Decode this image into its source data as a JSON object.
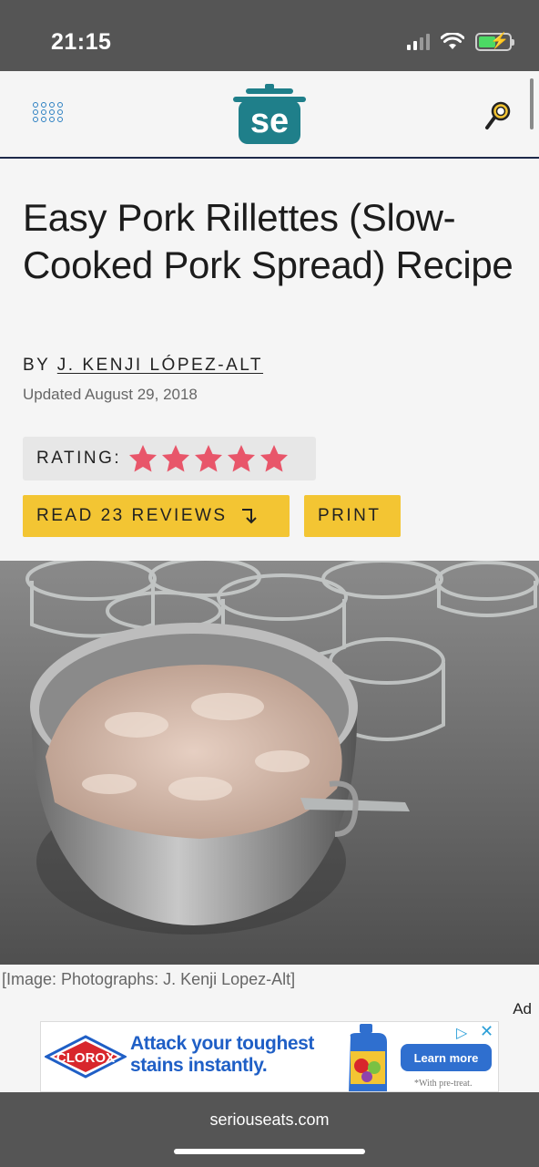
{
  "status_bar": {
    "time": "21:15"
  },
  "header": {
    "logo_text": "se"
  },
  "article": {
    "title": "Easy Pork Rillettes (Slow-Cooked Pork Spread) Recipe",
    "by_prefix": "BY",
    "author": "J. KENJI LÓPEZ-ALT",
    "updated": "Updated August 29, 2018",
    "rating_label": "RATING:",
    "rating_stars": 5,
    "rating_max": 5,
    "reviews_button": "READ 23 REVIEWS",
    "print_button": "PRINT",
    "caption": "[Image: Photographs: J. Kenji Lopez-Alt]"
  },
  "ad": {
    "label": "Ad",
    "brand": "CLOROX",
    "headline_line1": "Attack your toughest",
    "headline_line2": "stains instantly.",
    "cta": "Learn more",
    "fine_print": "*With pre-treat."
  },
  "browser": {
    "url": "seriouseats.com"
  },
  "colors": {
    "accent_yellow": "#f3c533",
    "star_red": "#e8566a",
    "logo_teal": "#1f7f8a",
    "chrome_gray": "#555555"
  },
  "icons": [
    "menu-grid-icon",
    "logo-pot-icon",
    "search-icon",
    "star-icon",
    "arrow-down-return-icon",
    "signal-icon",
    "wifi-icon",
    "battery-icon"
  ]
}
